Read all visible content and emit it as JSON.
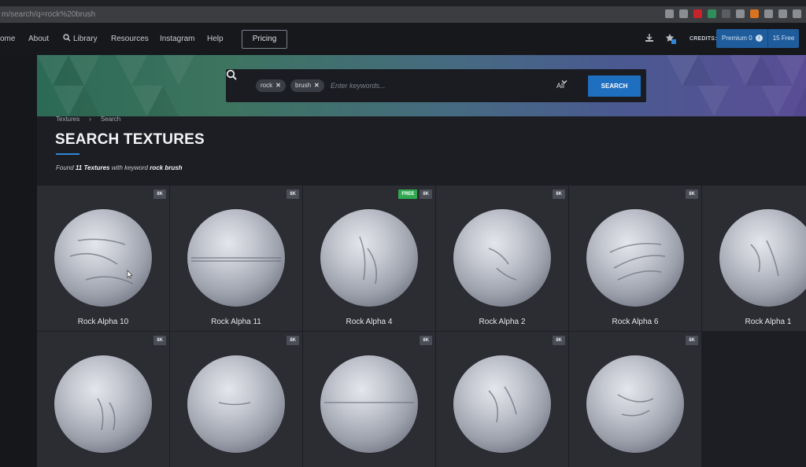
{
  "browser": {
    "url": "m/search/q=rock%20brush"
  },
  "nav": {
    "items": [
      "ome",
      "About",
      "Library",
      "Resources",
      "Instagram",
      "Help"
    ],
    "pricing": "Pricing",
    "credits_label": "CREDITS:",
    "premium": "Premium 0",
    "free": "15 Free"
  },
  "search": {
    "chips": [
      "rock",
      "brush"
    ],
    "placeholder": "Enter keywords...",
    "filter": "All",
    "button": "SEARCH"
  },
  "breadcrumb": [
    "Textures",
    "Search"
  ],
  "title": "SEARCH TEXTURES",
  "found": {
    "prefix": "Found",
    "count": "11 Textures",
    "middle": "with keyword",
    "keyword": "rock brush"
  },
  "cards": [
    {
      "name": "Rock Alpha 10",
      "badges": [
        "8K"
      ]
    },
    {
      "name": "Rock Alpha 11",
      "badges": [
        "8K"
      ]
    },
    {
      "name": "Rock Alpha 4",
      "badges": [
        "FREE",
        "8K"
      ]
    },
    {
      "name": "Rock Alpha 2",
      "badges": [
        "8K"
      ]
    },
    {
      "name": "Rock Alpha 6",
      "badges": [
        "8K"
      ]
    },
    {
      "name": "Rock Alpha 1",
      "badges": []
    },
    {
      "name": "",
      "badges": [
        "8K"
      ]
    },
    {
      "name": "",
      "badges": [
        "8K"
      ]
    },
    {
      "name": "",
      "badges": [
        "8K"
      ]
    },
    {
      "name": "",
      "badges": [
        "8K"
      ]
    },
    {
      "name": "",
      "badges": [
        "8K"
      ]
    }
  ],
  "colors": {
    "accent": "#1f6fc0",
    "free_badge": "#2fa84f",
    "background": "#1c1e23",
    "card": "#2b2d33"
  }
}
